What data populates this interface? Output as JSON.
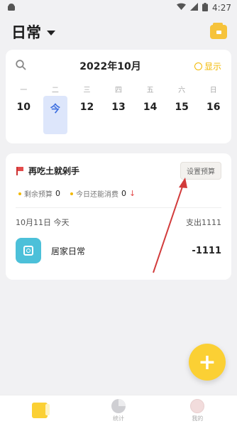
{
  "status_bar": {
    "time": "4:27"
  },
  "header": {
    "book_title": "日常",
    "wallet_icon": "wallet-icon"
  },
  "calendar": {
    "month_label": "2022年10月",
    "show_label": "显示",
    "weekdays": [
      "一",
      "二",
      "三",
      "四",
      "五",
      "六",
      "日"
    ],
    "days": [
      "10",
      "今",
      "12",
      "13",
      "14",
      "15",
      "16"
    ]
  },
  "budget": {
    "name": "再吃土就剁手",
    "set_budget_label": "设置预算",
    "remaining_label": "剩余预算",
    "remaining_value": "0",
    "today_label": "今日还能消费",
    "today_value": "0"
  },
  "day_summary": {
    "date_label": "10月11日 今天",
    "spend_label": "支出1111"
  },
  "record": {
    "name": "居家日常",
    "amount": "-1111"
  },
  "fab_label": "+",
  "bottom_nav": {
    "items": [
      {
        "label": ""
      },
      {
        "label": "统计"
      },
      {
        "label": "我的"
      }
    ]
  },
  "colors": {
    "accent": "#fbd034",
    "today_bg": "#dde6fb",
    "today_text": "#3d6fe0",
    "arrow": "#d23b3b"
  }
}
